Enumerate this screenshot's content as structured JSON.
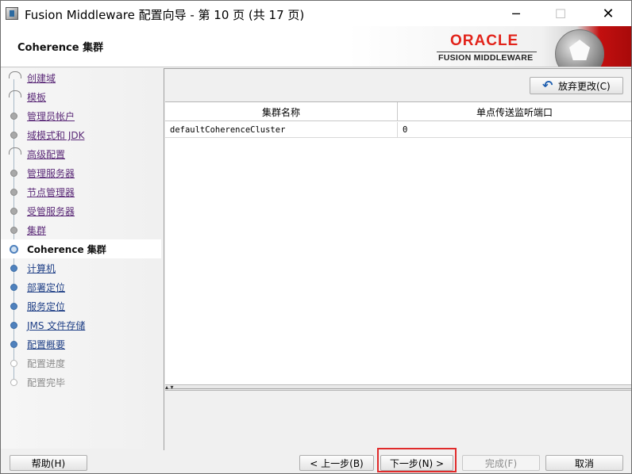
{
  "window": {
    "title": "Fusion Middleware 配置向导 - 第 10 页 (共 17 页)",
    "minimize_glyph": "─",
    "maximize_glyph": "☐",
    "close_glyph": "✕"
  },
  "banner": {
    "title": "Coherence 集群",
    "logo_word": "ORACLE",
    "logo_sub": "FUSION MIDDLEWARE"
  },
  "nav": {
    "items": [
      {
        "label": "创建域",
        "state": "done"
      },
      {
        "label": "模板",
        "state": "done"
      },
      {
        "label": "管理员帐户",
        "state": "done"
      },
      {
        "label": "域模式和 JDK",
        "state": "done"
      },
      {
        "label": "高级配置",
        "state": "done"
      },
      {
        "label": "管理服务器",
        "state": "done"
      },
      {
        "label": "节点管理器",
        "state": "done"
      },
      {
        "label": "受管服务器",
        "state": "done"
      },
      {
        "label": "集群",
        "state": "done"
      },
      {
        "label": "Coherence 集群",
        "state": "current"
      },
      {
        "label": "计算机",
        "state": "upcoming"
      },
      {
        "label": "部署定位",
        "state": "upcoming"
      },
      {
        "label": "服务定位",
        "state": "upcoming"
      },
      {
        "label": "JMS 文件存储",
        "state": "upcoming"
      },
      {
        "label": "配置概要",
        "state": "upcoming"
      },
      {
        "label": "配置进度",
        "state": "pending"
      },
      {
        "label": "配置完毕",
        "state": "pending"
      }
    ]
  },
  "content": {
    "discard_label": "放弃更改(C)",
    "table": {
      "columns": [
        "集群名称",
        "单点传送监听端口"
      ],
      "rows": [
        [
          "defaultCoherenceCluster",
          "0"
        ]
      ]
    },
    "splitter_grip": "▴ ▾"
  },
  "footer": {
    "help_label": "帮助(H)",
    "back_label": "< 上一步(B)",
    "next_label": "下一步(N) >",
    "finish_label": "完成(F)",
    "cancel_label": "取消"
  },
  "colors": {
    "oracle_red": "#e2231a",
    "highlight": "#e02b2b",
    "nav_done_link": "#5b2a78",
    "nav_upcoming_link": "#1f3f86"
  }
}
